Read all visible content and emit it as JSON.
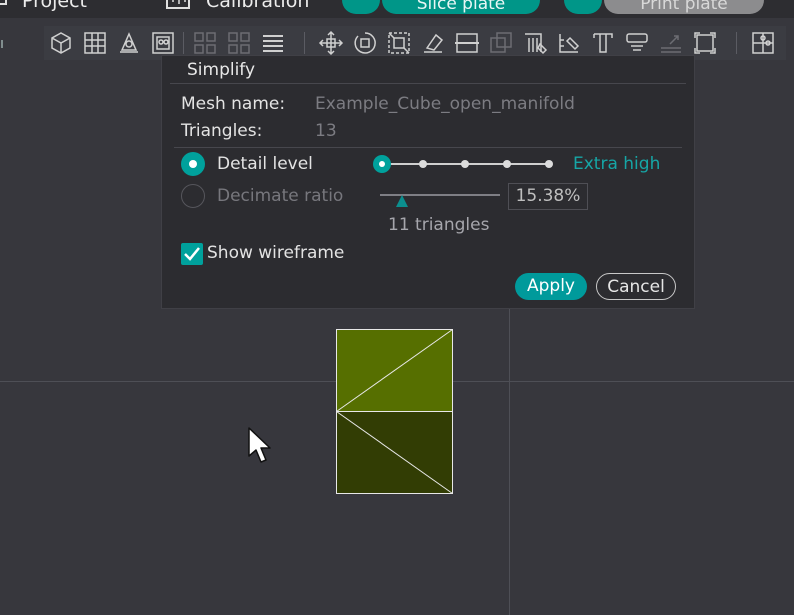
{
  "header": {
    "project_label": "Project",
    "calibration_label": "Calibration",
    "slice_plate_label": "Slice plate",
    "print_plate_label": "Print plate"
  },
  "toolbar": {
    "tools": [
      "add-cube-icon",
      "grid-icon",
      "orient-icon",
      "arrange-icon",
      "split-objects-icon",
      "split-parts-icon",
      "layers-icon",
      "move-icon",
      "rotate-icon",
      "scale-icon",
      "cut-icon",
      "plane-cut-icon",
      "boolean-icon",
      "support-paint-icon",
      "seam-paint-icon",
      "text-icon",
      "measure-icon",
      "assembly-icon",
      "fit-view-icon",
      "puzzle-icon"
    ]
  },
  "dialog": {
    "title": "Simplify",
    "mesh_name_label": "Mesh name:",
    "mesh_name_value": "Example_Cube_open_manifold",
    "triangles_label": "Triangles:",
    "triangles_value": "13",
    "detail_level_label": "Detail level",
    "detail_level_value": "Extra high",
    "detail_level_steps": 5,
    "detail_level_selected_index": 0,
    "decimate_ratio_label": "Decimate ratio",
    "decimate_ratio_value": "15.38%",
    "decimate_ratio_fraction": 0.15,
    "triangles_result": "11 triangles",
    "show_wireframe_label": "Show wireframe",
    "show_wireframe_checked": true,
    "apply_label": "Apply",
    "cancel_label": "Cancel"
  },
  "colors": {
    "accent": "#009a9b",
    "background": "#37373d",
    "dialog_background": "#2c2c30",
    "mesh_top": "#566f00",
    "mesh_bottom": "#323d04"
  }
}
